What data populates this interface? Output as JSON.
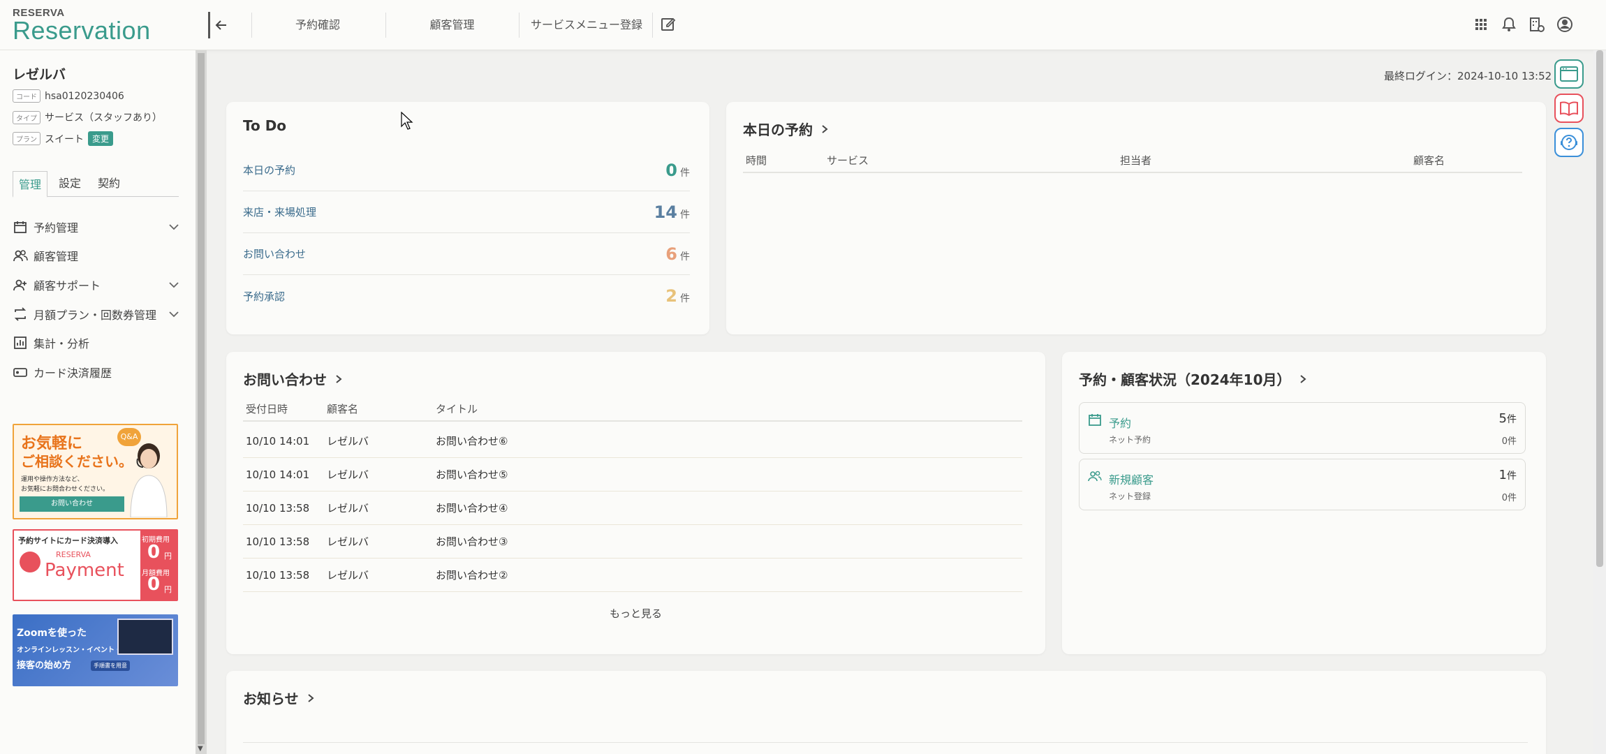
{
  "header": {
    "logo_small": "RESERVA",
    "logo_big": "Reservation",
    "nav": [
      "予約確認",
      "顧客管理",
      "サービスメニュー登録"
    ]
  },
  "sidebar": {
    "shop_name": "レゼルバ",
    "meta": {
      "code_tag": "コード",
      "code_value": "hsa0120230406",
      "type_tag": "タイプ",
      "type_value": "サービス（スタッフあり）",
      "plan_tag": "プラン",
      "plan_value": "スイート",
      "change_label": "変更"
    },
    "tabs": [
      "管理",
      "設定",
      "契約"
    ],
    "menu": [
      {
        "label": "予約管理",
        "icon": "calendar-icon",
        "expandable": true
      },
      {
        "label": "顧客管理",
        "icon": "users-icon",
        "expandable": false
      },
      {
        "label": "顧客サポート",
        "icon": "user-plus-icon",
        "expandable": true
      },
      {
        "label": "月額プラン・回数券管理",
        "icon": "repeat-icon",
        "expandable": true
      },
      {
        "label": "集計・分析",
        "icon": "chart-icon",
        "expandable": false
      },
      {
        "label": "カード決済履歴",
        "icon": "card-icon",
        "expandable": false
      }
    ],
    "banner1": {
      "line1": "お気軽に",
      "line2": "ご相談ください。",
      "qa": "Q&A",
      "text1": "運用や操作方法など、",
      "text2": "お気軽にお問合わせください。",
      "button": "お問い合わせ"
    },
    "banner2": {
      "head": "予約サイトにカード決済導入",
      "brand_small": "RESERVA",
      "brand": "Payment",
      "fee1_label": "初期費用",
      "fee1": "0",
      "fee2_label": "月額費用",
      "fee2": "0",
      "yen": "円"
    },
    "banner3": {
      "line1": "Zoomを使った",
      "line2": "オンラインレッスン・イベント・",
      "line3": "接客の始め方",
      "badge": "手順書を用意"
    }
  },
  "last_login": "最終ログイン：2024-10-10 13:52",
  "todo": {
    "title": "To Do",
    "unit": "件",
    "items": [
      {
        "label": "本日の予約",
        "count": "0",
        "color": "#3a9b8c"
      },
      {
        "label": "来店・来場処理",
        "count": "14",
        "color": "#5a7fa0"
      },
      {
        "label": "お問い合わせ",
        "count": "6",
        "color": "#e8a07a"
      },
      {
        "label": "予約承認",
        "count": "2",
        "color": "#e8c27a"
      }
    ]
  },
  "today": {
    "title": "本日の予約",
    "headers": [
      "時間",
      "サービス",
      "担当者",
      "顧客名"
    ]
  },
  "inquiries": {
    "title": "お問い合わせ",
    "headers": [
      "受付日時",
      "顧客名",
      "タイトル"
    ],
    "rows": [
      [
        "10/10 14:01",
        "レゼルバ",
        "お問い合わせ⑥"
      ],
      [
        "10/10 14:01",
        "レゼルバ",
        "お問い合わせ⑤"
      ],
      [
        "10/10 13:58",
        "レゼルバ",
        "お問い合わせ④"
      ],
      [
        "10/10 13:58",
        "レゼルバ",
        "お問い合わせ③"
      ],
      [
        "10/10 13:58",
        "レゼルバ",
        "お問い合わせ②"
      ]
    ],
    "more": "もっと見る"
  },
  "status": {
    "title": "予約・顧客状況（2024年10月）",
    "items": [
      {
        "name": "予約",
        "sub": "ネット予約",
        "value": "5",
        "unit": "件",
        "sub_value": "0件"
      },
      {
        "name": "新規顧客",
        "sub": "ネット登録",
        "value": "1",
        "unit": "件",
        "sub_value": "0件"
      }
    ]
  },
  "news": {
    "title": "お知らせ"
  },
  "colors": {
    "accent": "#3a9b8c",
    "pink": "#e8515c",
    "blue": "#3a8fd9"
  }
}
